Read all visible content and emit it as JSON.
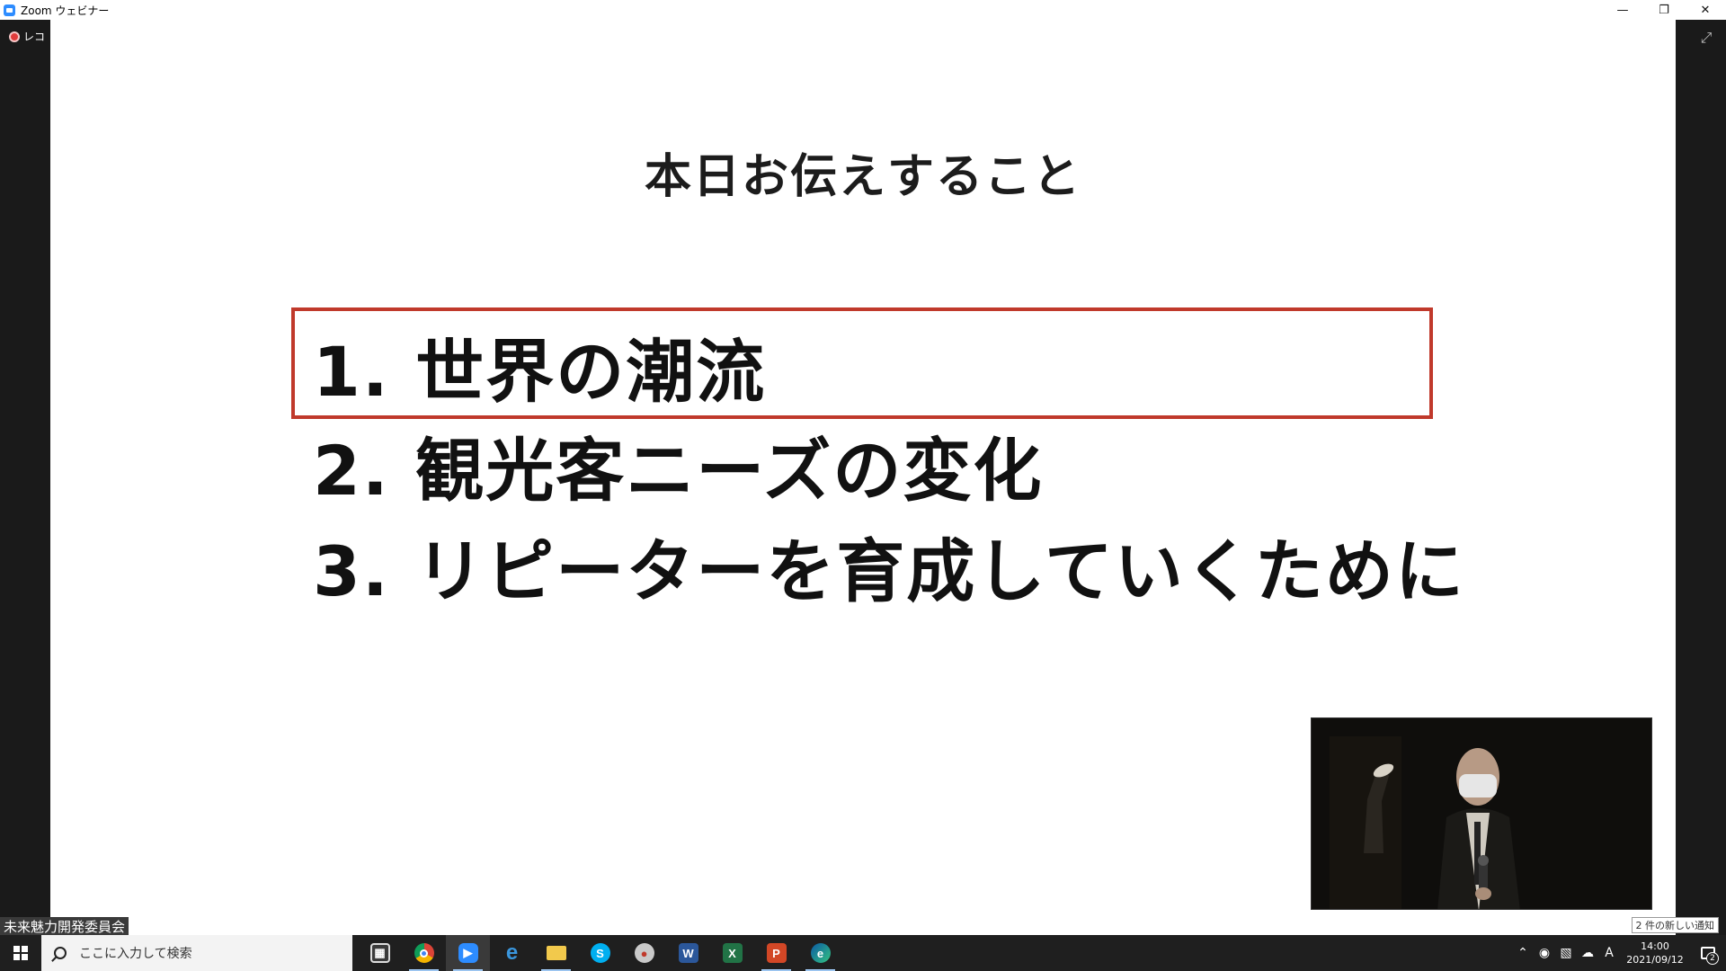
{
  "window": {
    "title": "Zoom ウェビナー"
  },
  "recording": {
    "label": "レコーディング中"
  },
  "slide": {
    "title": "本日お伝えすること",
    "items": [
      "1. 世界の潮流",
      "2. 観光客ニーズの変化",
      "3. リピーターを育成していくために"
    ],
    "highlight_color": "#c0392b"
  },
  "video": {
    "speaker_name": "未来魅力開発委員会"
  },
  "notification": {
    "text": "2 件の新しい通知"
  },
  "taskbar": {
    "search_placeholder": "ここに入力して検索",
    "apps": [
      "Microsoft Store",
      "Google Chrome",
      "Zoom",
      "Internet Explorer",
      "File Explorer",
      "Skype",
      "App",
      "Word",
      "Excel",
      "PowerPoint",
      "Microsoft Edge"
    ],
    "ime": "A",
    "time": "14:00",
    "date": "2021/09/12",
    "notification_count": "2"
  }
}
